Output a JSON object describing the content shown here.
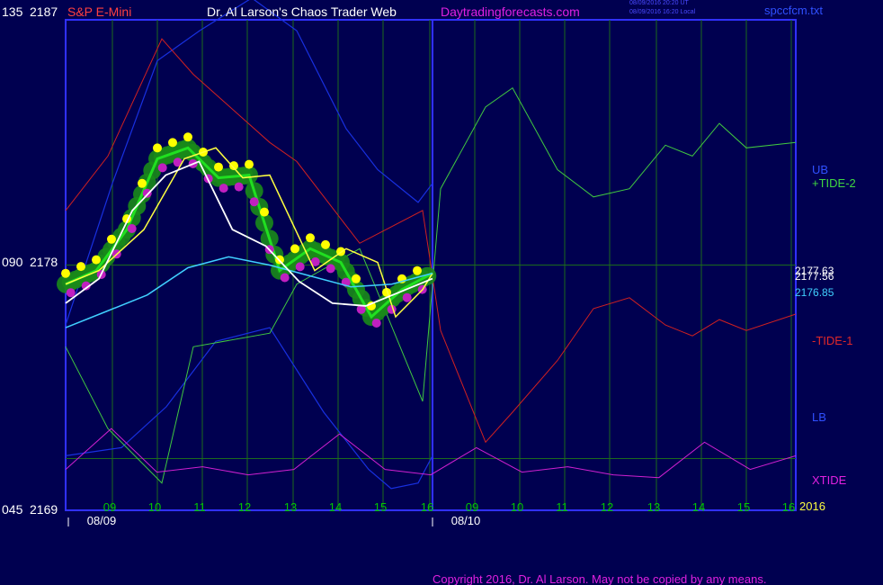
{
  "header": {
    "left_value": "135",
    "left_price": "2187",
    "instrument": "S&P E-Mini",
    "title": "Dr. Al Larson's Chaos Trader Web",
    "site": "Daytradingforecasts.com",
    "stamp_ut": "08/09/2016 20:20 UT",
    "stamp_local": "08/09/2016 16:20 Local",
    "file": "spccfcm.txt"
  },
  "axis": {
    "mid_value": "090",
    "mid_price": "2178",
    "bottom_value": "045",
    "bottom_price": "2169",
    "year": "2016",
    "hours": [
      "09",
      "10",
      "11",
      "12",
      "13",
      "14",
      "15",
      "16",
      "09",
      "10",
      "11",
      "12",
      "13",
      "14",
      "15",
      "16"
    ],
    "dates": [
      "08/09",
      "08/10"
    ]
  },
  "right_labels": {
    "ub": "UB",
    "tide2": "+TIDE-2",
    "price1": "2177.63",
    "price2": "2177.56",
    "price3": "2176.85",
    "tide1": "-TIDE-1",
    "lb": "LB",
    "xtide": "XTIDE"
  },
  "footer": {
    "copyright": "Copyright 2016, Dr. Al Larson. May not be copied by any means."
  },
  "colors": {
    "background": "#000050",
    "frame": "#3030ff",
    "grid": "#1c6a1c",
    "hour_labels": "#00c800",
    "date_labels": "#ffffff",
    "tide2": "#40c840",
    "tide1": "#d02020",
    "bands": "#1830e0",
    "xtide": "#d020d0",
    "price": "#20e020",
    "ma_fast": "#ffff40",
    "ma_mid": "#40d0ff",
    "ma_slow": "#ffffff",
    "glow": "#1a8a1a",
    "highs": "#ffff00",
    "lows": "#c020c0"
  },
  "chart_data": {
    "type": "line",
    "x_ticks": [
      "09",
      "10",
      "11",
      "12",
      "13",
      "14",
      "15",
      "16",
      "09",
      "10",
      "11",
      "12",
      "13",
      "14",
      "15",
      "16"
    ],
    "ylim": [
      2169,
      2187
    ],
    "series": [
      {
        "name": "UB",
        "values": [
          2175.8,
          2181.0,
          2185.5,
          2186.6,
          2187.8,
          2186.6,
          2183.0,
          2181.5,
          2180.3,
          2181.0
        ]
      },
      {
        "name": "LB",
        "values": [
          2171.0,
          2171.3,
          2172.8,
          2175.2,
          2175.7,
          2172.6,
          2170.5,
          2169.8,
          2170.0,
          2171.0
        ]
      },
      {
        "name": "+TIDE-2",
        "values": [
          2175.0,
          2172.0,
          2170.0,
          2175.0,
          2175.5,
          2177.3,
          2178.6,
          2173.0,
          2180.8,
          2183.8,
          2184.5,
          2181.5,
          2180.5,
          2180.8,
          2182.4,
          2182.0,
          2183.2,
          2182.3,
          2182.5
        ]
      },
      {
        "name": "-TIDE-1",
        "values": [
          2180.0,
          2182.0,
          2186.3,
          2185.0,
          2182.5,
          2181.8,
          2178.8,
          2180.0,
          2175.6,
          2171.5,
          2172.6,
          2174.5,
          2176.4,
          2176.8,
          2175.8,
          2175.4,
          2176.0,
          2175.6,
          2176.2
        ]
      },
      {
        "name": "XTIDE",
        "values": [
          2170.5,
          2172.0,
          2170.4,
          2170.6,
          2170.3,
          2170.5,
          2171.8,
          2170.5,
          2170.3,
          2171.3,
          2170.4,
          2170.6,
          2170.3,
          2170.2,
          2171.5,
          2170.5,
          2171.0
        ]
      },
      {
        "name": "2177.63",
        "values": [
          2177.3,
          2177.8,
          2179.3,
          2181.9,
          2182.3,
          2181.2,
          2181.3,
          2177.8,
          2178.6,
          2178.1,
          2176.1,
          2177.1,
          2177.7
        ]
      },
      {
        "name": "2177.56",
        "values": [
          2176.6,
          2177.5,
          2180.0,
          2181.3,
          2181.8,
          2179.3,
          2178.7,
          2177.4,
          2176.6,
          2176.5,
          2177.0,
          2177.5
        ]
      },
      {
        "name": "2176.85",
        "values": [
          2175.7,
          2176.3,
          2176.9,
          2177.9,
          2178.3,
          2178.0,
          2177.6,
          2177.2,
          2177.3,
          2177.7
        ]
      }
    ]
  }
}
